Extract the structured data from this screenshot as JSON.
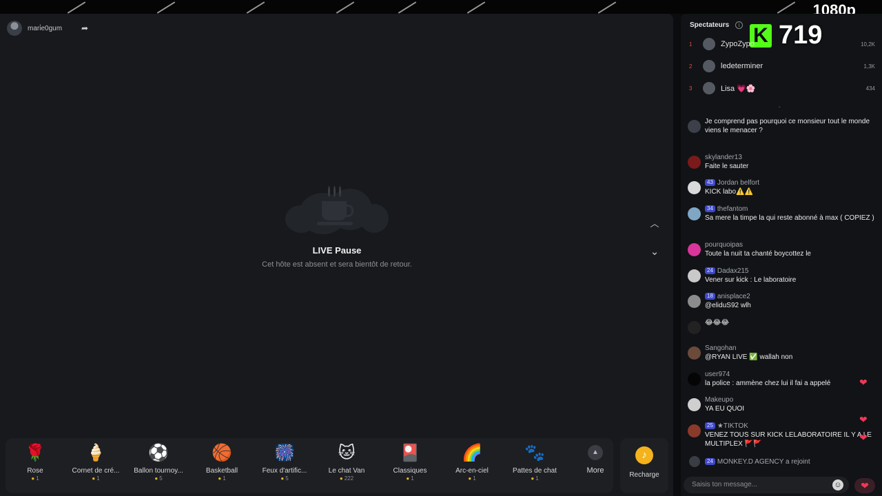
{
  "overlay": {
    "resolution": "1080p"
  },
  "stream": {
    "host_name": "mari̇e0gum",
    "pause_title": "LIVE Pause",
    "pause_subtitle": "Cet hôte est absent et sera bientôt de retour."
  },
  "gifts": [
    {
      "icon": "rose-icon",
      "glyph": "🌹",
      "label": "Rose",
      "price": "1"
    },
    {
      "icon": "ice-cream-icon",
      "glyph": "🍦",
      "label": "Cornet de cré...",
      "price": "1"
    },
    {
      "icon": "soccer-ball-icon",
      "glyph": "⚽",
      "label": "Ballon tournoy...",
      "price": "5"
    },
    {
      "icon": "basketball-icon",
      "glyph": "🏀",
      "label": "Basketball",
      "price": "1"
    },
    {
      "icon": "fireworks-icon",
      "glyph": "🎆",
      "label": "Feux d'artific...",
      "price": "5"
    },
    {
      "icon": "cat-icon",
      "glyph": "🐱",
      "label": "Le chat Van",
      "price": "222"
    },
    {
      "icon": "card-icon",
      "glyph": "🎴",
      "label": "Classiques",
      "price": "1"
    },
    {
      "icon": "rainbow-icon",
      "glyph": "🌈",
      "label": "Arc-en-ciel",
      "price": "1"
    },
    {
      "icon": "paw-icon",
      "glyph": "🐾",
      "label": "Pattes de chat",
      "price": "1"
    }
  ],
  "more_label": "More",
  "recharge_label": "Recharge",
  "sidebar": {
    "viewers_title": "Spectateurs",
    "kick_count": "719",
    "viewers": [
      {
        "rank": "1",
        "name": "ZypoZypo",
        "score": "10,2K"
      },
      {
        "rank": "2",
        "name": "ledeterminer",
        "score": "1,3K"
      },
      {
        "rank": "3",
        "name": "Lisa 💗🌸",
        "score": "434"
      }
    ]
  },
  "chat": [
    {
      "badge": "",
      "user": "",
      "text": "Je comprend pas pourquoi ce monsieur tout le monde viens le menacer ?"
    },
    {
      "badge": "",
      "user": "skylander13",
      "text": "Faite le sauter"
    },
    {
      "badge": "43",
      "user": "Jordan belfort",
      "text": "KICK labo⚠️⚠️"
    },
    {
      "badge": "34",
      "user": "thefantom",
      "text": "Sa mere la timpe la qui reste abonné à max ( COPIEZ )"
    },
    {
      "badge": "",
      "user": "pourquoipas",
      "text": "Toute la nuit ta chanté boycottez le"
    },
    {
      "badge": "24",
      "user": "Dadax215",
      "text": "Vener sur kick : Le laboratoire"
    },
    {
      "badge": "18",
      "user": "anisplace2",
      "text": "@eliduS92 wlh"
    },
    {
      "badge": "",
      "user": "",
      "text": "😂😂😂"
    },
    {
      "badge": "",
      "user": "Sangohan",
      "text": "@RYAN LIVE ✅ wallah non"
    },
    {
      "badge": "",
      "user": "user974",
      "text": "la police : ammène chez lui il fai a appelé"
    },
    {
      "badge": "",
      "user": "Makeupo",
      "text": "YA EU QUOI"
    },
    {
      "badge": "25",
      "user": "★TIKTOK",
      "text": "VENEZ TOUS SUR KICK LELABORATOIRE IL Y A LE MULTIPLEX 🚩🚩"
    },
    {
      "badge": "24",
      "user": "MONKEY.D AGENCY",
      "text": "a rejoint"
    }
  ],
  "input": {
    "placeholder": "Saisis ton message..."
  }
}
